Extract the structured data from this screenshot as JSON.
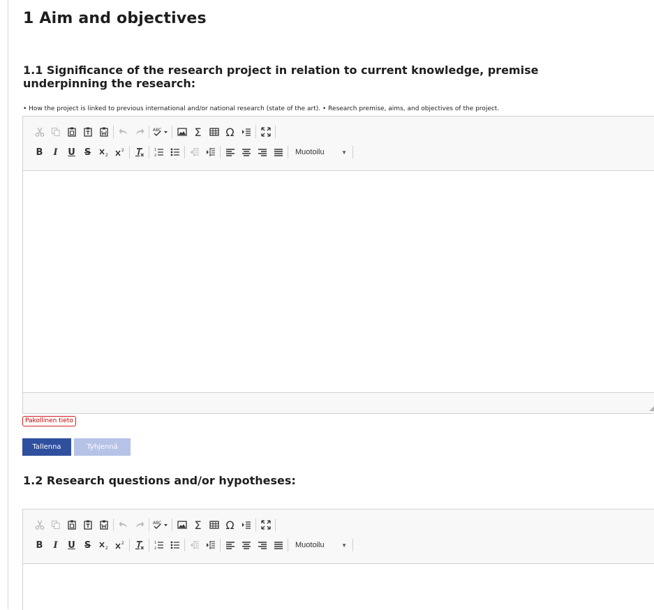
{
  "section": {
    "title": "1 Aim and objectives"
  },
  "questions": [
    {
      "heading": "1.1 Significance of the research project in relation to current knowledge, premise underpinning the research:",
      "hint": "• How the project is linked to previous international and/or national research (state of the art). • Research premise, aims, and objectives of the project.",
      "value": "",
      "required_label": "Pakollinen tieto",
      "save_label": "Tallenna",
      "clear_label": "Tyhjennä"
    },
    {
      "heading": "1.2 Research questions and/or hypotheses:",
      "value": ""
    }
  ],
  "toolbar": {
    "row1_icons": [
      "cut-icon",
      "copy-icon",
      "paste-icon",
      "paste-text-icon",
      "paste-from-word-icon",
      "undo-icon",
      "redo-icon",
      "spellcheck-icon",
      "image-icon",
      "math-sum-icon",
      "table-icon",
      "special-char-icon",
      "outdent-icon",
      "maximize-icon"
    ],
    "row2_icons": [
      "bold-icon",
      "italic-icon",
      "underline-icon",
      "strikethrough-icon",
      "subscript-icon",
      "superscript-icon",
      "remove-format-icon",
      "numbered-list-icon",
      "bulleted-list-icon",
      "decrease-indent-icon",
      "increase-indent-icon",
      "align-left-icon",
      "align-center-icon",
      "align-right-icon",
      "justify-icon"
    ],
    "glyphs": {
      "bold": "B",
      "italic": "I",
      "underline": "U",
      "strike": "S",
      "sum": "Σ",
      "omega": "Ω"
    },
    "format_label": "Muotoilu"
  },
  "colors": {
    "primary_button": "#2f4f9f",
    "disabled_button": "#b6c2e6",
    "required_red": "#c00000"
  }
}
